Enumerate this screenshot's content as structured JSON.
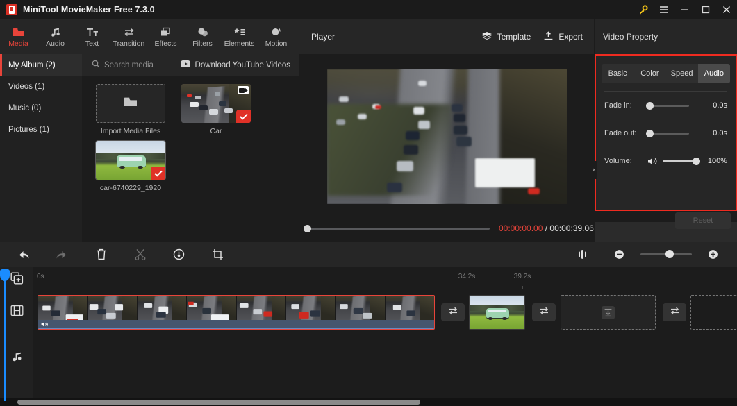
{
  "window": {
    "title": "MiniTool MovieMaker Free 7.3.0",
    "logo_icon": "moviemaker-logo-icon",
    "buttons": [
      {
        "name": "key-icon",
        "label": "",
        "color": "#f5c518"
      },
      {
        "name": "menu-icon",
        "label": ""
      },
      {
        "name": "minimize-icon",
        "label": ""
      },
      {
        "name": "maximize-icon",
        "label": ""
      },
      {
        "name": "close-icon",
        "label": ""
      }
    ]
  },
  "tool_tabs": [
    {
      "label": "Media",
      "icon": "folder-icon",
      "active": true
    },
    {
      "label": "Audio",
      "icon": "music-note-icon",
      "active": false
    },
    {
      "label": "Text",
      "icon": "text-tt-icon",
      "active": false
    },
    {
      "label": "Transition",
      "icon": "transition-arrows-icon",
      "active": false
    },
    {
      "label": "Effects",
      "icon": "effects-squares-icon",
      "active": false
    },
    {
      "label": "Filters",
      "icon": "filters-circles-icon",
      "active": false
    },
    {
      "label": "Elements",
      "icon": "elements-star-list-icon",
      "active": false
    },
    {
      "label": "Motion",
      "icon": "motion-circle-icon",
      "active": false
    }
  ],
  "media_library": {
    "sidebar": [
      {
        "label": "My Album (2)",
        "active": true
      },
      {
        "label": "Videos (1)",
        "active": false
      },
      {
        "label": "Music (0)",
        "active": false
      },
      {
        "label": "Pictures (1)",
        "active": false
      }
    ],
    "search": {
      "placeholder": "Search media",
      "icon": "search-icon"
    },
    "download_youtube": {
      "label": "Download YouTube Videos",
      "icon": "youtube-download-icon"
    },
    "import_tile": {
      "label": "Import Media Files",
      "icon": "folder-open-icon"
    },
    "items": [
      {
        "label": "Car",
        "type": "video",
        "selected": true,
        "art": "highway"
      },
      {
        "label": "car-6740229_1920",
        "type": "image",
        "selected": true,
        "art": "van"
      }
    ],
    "check_color": "#e03127"
  },
  "player": {
    "title": "Player",
    "actions": [
      {
        "label": "Template",
        "icon": "layers-icon"
      },
      {
        "label": "Export",
        "icon": "export-upload-icon"
      }
    ],
    "current_time": "00:00:00.00",
    "separator": " / ",
    "total_time": "00:00:39.06",
    "current_time_color": "#e8443a",
    "seek_position_percent": 0,
    "controls": [
      {
        "name": "play-button",
        "icon": "play-icon"
      },
      {
        "name": "previous-frame-button",
        "icon": "skip-previous-icon"
      },
      {
        "name": "next-frame-button",
        "icon": "skip-next-icon"
      },
      {
        "name": "stop-button",
        "icon": "stop-icon"
      },
      {
        "name": "mute-button",
        "icon": "speaker-icon"
      }
    ],
    "volume_percent": 100,
    "aspect_ratio": "16:9",
    "fullscreen_icon": "fullscreen-icon"
  },
  "video_property": {
    "title": "Video Property",
    "highlight_color": "#ef2b20",
    "tabs": [
      {
        "label": "Basic",
        "active": false
      },
      {
        "label": "Color",
        "active": false
      },
      {
        "label": "Speed",
        "active": false
      },
      {
        "label": "Audio",
        "active": true
      }
    ],
    "rows": [
      {
        "label": "Fade in:",
        "value": "0.0s",
        "knob": "left"
      },
      {
        "label": "Fade out:",
        "value": "0.0s",
        "knob": "left"
      }
    ],
    "volume": {
      "label": "Volume:",
      "value": "100%",
      "icon": "speaker-icon",
      "knob": "right"
    },
    "reset_label": "Reset",
    "collapse_icon": "chevron-right-icon"
  },
  "timeline": {
    "toolbar": [
      {
        "name": "undo-button",
        "icon": "undo-icon",
        "enabled": true
      },
      {
        "name": "redo-button",
        "icon": "redo-icon",
        "enabled": false
      },
      {
        "name": "delete-button",
        "icon": "trash-icon",
        "enabled": true
      },
      {
        "name": "split-button",
        "icon": "scissors-icon",
        "enabled": false
      },
      {
        "name": "speed-button",
        "icon": "speed-gauge-icon",
        "enabled": true
      },
      {
        "name": "crop-button",
        "icon": "crop-icon",
        "enabled": true
      }
    ],
    "zoom": {
      "fit_icon": "fit-timeline-icon",
      "minus_icon": "zoom-out-icon",
      "plus_icon": "zoom-in-icon",
      "value_percent": 50
    },
    "rail": [
      {
        "name": "add-media-track-button",
        "icon": "add-media-icon"
      },
      {
        "name": "video-track-header",
        "icon": "film-strip-icon"
      },
      {
        "name": "audio-track-header",
        "icon": "music-note-icon"
      }
    ],
    "ruler_ticks": [
      "0s",
      "34.2s",
      "39.2s"
    ],
    "playhead_time": "0s",
    "playhead_color": "#1a8cff",
    "clips": [
      {
        "name": "video-clip-car",
        "type": "video",
        "selected": true,
        "frames": 8,
        "audio_icon": "speaker-icon"
      },
      {
        "name": "image-clip-van",
        "type": "image",
        "selected": false
      }
    ],
    "transitions": [
      {
        "name": "transition-slot-1",
        "icon": "transition-arrows-icon"
      },
      {
        "name": "transition-slot-2",
        "icon": "transition-arrows-icon"
      },
      {
        "name": "transition-slot-3",
        "icon": "transition-arrows-icon"
      }
    ],
    "dropzones": [
      {
        "name": "media-dropzone-1",
        "icon": "download-into-icon"
      },
      {
        "name": "media-dropzone-2",
        "icon": ""
      }
    ]
  }
}
